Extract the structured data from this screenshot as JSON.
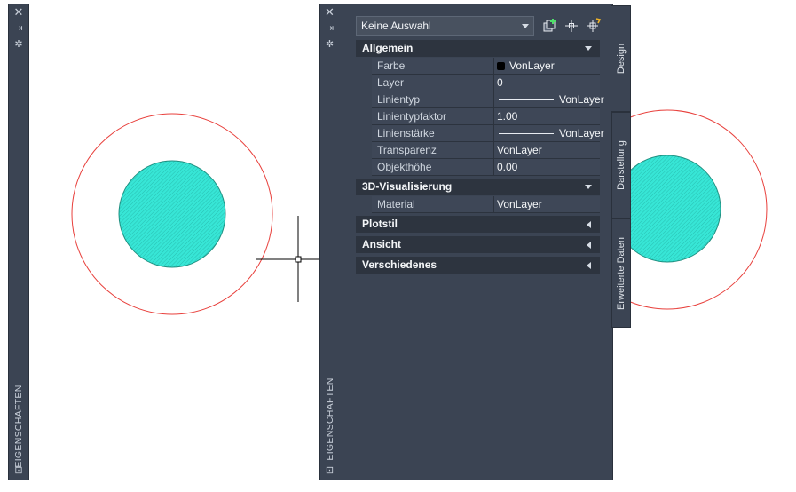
{
  "left_strip": {
    "title": "EIGENSCHAFTEN",
    "icons": [
      "close-icon",
      "auto-hide-icon",
      "settings-icon",
      "palette-properties-icon"
    ]
  },
  "palette": {
    "title": "EIGENSCHAFTEN",
    "selection": "Keine Auswahl",
    "tools": [
      "toggle-pickadd-icon",
      "select-objects-icon",
      "quick-select-icon"
    ],
    "categories": [
      {
        "label": "Allgemein",
        "expanded": true,
        "rows": [
          {
            "name": "Farbe",
            "value": "VonLayer",
            "kind": "color",
            "swatch": "#000000"
          },
          {
            "name": "Layer",
            "value": "0",
            "kind": "text"
          },
          {
            "name": "Linientyp",
            "value": "VonLayer",
            "kind": "line"
          },
          {
            "name": "Linientypfaktor",
            "value": "1.00",
            "kind": "text"
          },
          {
            "name": "Linienstärke",
            "value": "VonLayer",
            "kind": "line"
          },
          {
            "name": "Transparenz",
            "value": "VonLayer",
            "kind": "text"
          },
          {
            "name": "Objekthöhe",
            "value": "0.00",
            "kind": "text"
          }
        ]
      },
      {
        "label": "3D-Visualisierung",
        "expanded": true,
        "rows": [
          {
            "name": "Material",
            "value": "VonLayer",
            "kind": "text"
          }
        ]
      },
      {
        "label": "Plotstil",
        "expanded": false,
        "rows": []
      },
      {
        "label": "Ansicht",
        "expanded": false,
        "rows": []
      },
      {
        "label": "Verschiedenes",
        "expanded": false,
        "rows": []
      }
    ]
  },
  "side_tabs": [
    "Design",
    "Darstellung",
    "Erweiterte Daten"
  ],
  "colors": {
    "panel_bg": "#3b4453",
    "category_bg": "#2d343f",
    "circle_outline": "#e8403c",
    "hatch_fill": "#37e6d6"
  }
}
